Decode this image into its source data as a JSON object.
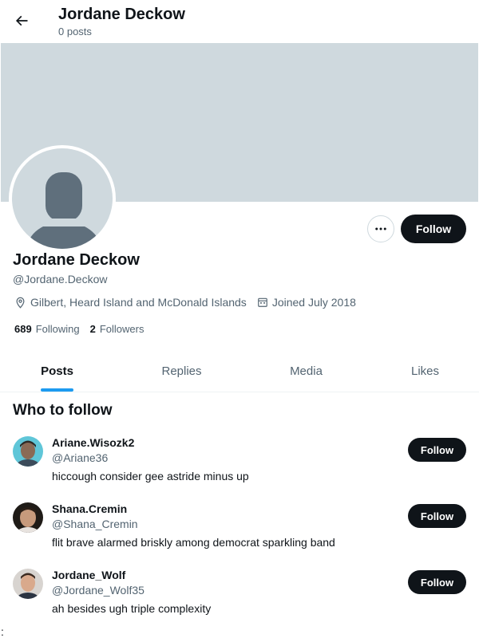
{
  "header": {
    "title": "Jordane Deckow",
    "post_count": "0 posts"
  },
  "profile": {
    "display_name": "Jordane Deckow",
    "handle": "@Jordane.Deckow",
    "location": "Gilbert, Heard Island and McDonald Islands",
    "joined": "Joined July 2018",
    "following_count": "689",
    "following_label": "Following",
    "followers_count": "2",
    "followers_label": "Followers",
    "follow_label": "Follow"
  },
  "tabs": [
    {
      "label": "Posts",
      "active": true
    },
    {
      "label": "Replies",
      "active": false
    },
    {
      "label": "Media",
      "active": false
    },
    {
      "label": "Likes",
      "active": false
    }
  ],
  "who_to_follow": {
    "title": "Who to follow",
    "suggestions": [
      {
        "name": "Ariane.Wisozk2",
        "handle": "@Ariane36",
        "bio": "hiccough consider gee astride minus up",
        "follow_label": "Follow"
      },
      {
        "name": "Shana.Cremin",
        "handle": "@Shana_Cremin",
        "bio": "flit brave alarmed briskly among democrat sparkling band",
        "follow_label": "Follow"
      },
      {
        "name": "Jordane_Wolf",
        "handle": "@Jordane_Wolf35",
        "bio": "ah besides ugh triple complexity",
        "follow_label": "Follow"
      }
    ]
  },
  "footer": {
    "stray_char": ":"
  },
  "colors": {
    "banner": "#cfd9de",
    "accent": "#1d9bf0",
    "button_dark": "#0f1419",
    "secondary_text": "#536471"
  },
  "icons": {
    "back": "arrow-left-icon",
    "more": "more-horizontal-icon",
    "location": "location-pin-icon",
    "calendar": "calendar-icon"
  }
}
